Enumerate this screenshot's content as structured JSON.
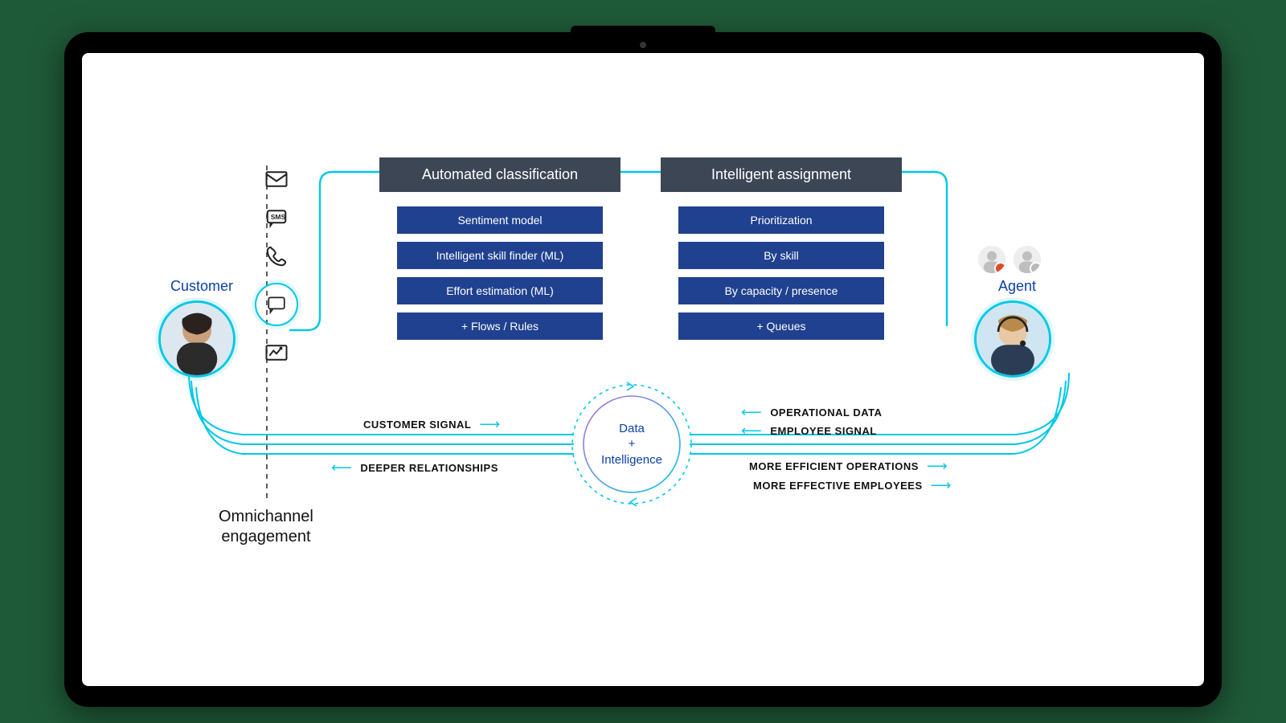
{
  "roles": {
    "customer": "Customer",
    "agent": "Agent"
  },
  "omnichannel_label_l1": "Omnichannel",
  "omnichannel_label_l2": "engagement",
  "channels": {
    "email": "email-icon",
    "sms": "sms-icon",
    "phone": "phone-icon",
    "chat": "chat-icon",
    "analytics": "analytics-icon"
  },
  "classification": {
    "header": "Automated classification",
    "items": [
      "Sentiment model",
      "Intelligent skill finder (ML)",
      "Effort estimation (ML)",
      "+ Flows / Rules"
    ]
  },
  "assignment": {
    "header": "Intelligent assignment",
    "items": [
      "Prioritization",
      "By skill",
      "By capacity / presence",
      "+ Queues"
    ]
  },
  "center": {
    "l1": "Data",
    "l2": "+",
    "l3": "Intelligence"
  },
  "flows": {
    "customer_signal": "CUSTOMER SIGNAL",
    "deeper_relationships": "DEEPER RELATIONSHIPS",
    "operational_data": "OPERATIONAL DATA",
    "employee_signal": "EMPLOYEE SIGNAL",
    "more_efficient": "MORE EFFICIENT OPERATIONS",
    "more_effective": "MORE EFFECTIVE EMPLOYEES"
  },
  "colors": {
    "cyan": "#00c8e8",
    "header_bg": "#3c4655",
    "pill_bg": "#20418f",
    "link_blue": "#0a3fa8"
  },
  "agent_status": {
    "mini1": "busy",
    "mini2": "away"
  }
}
